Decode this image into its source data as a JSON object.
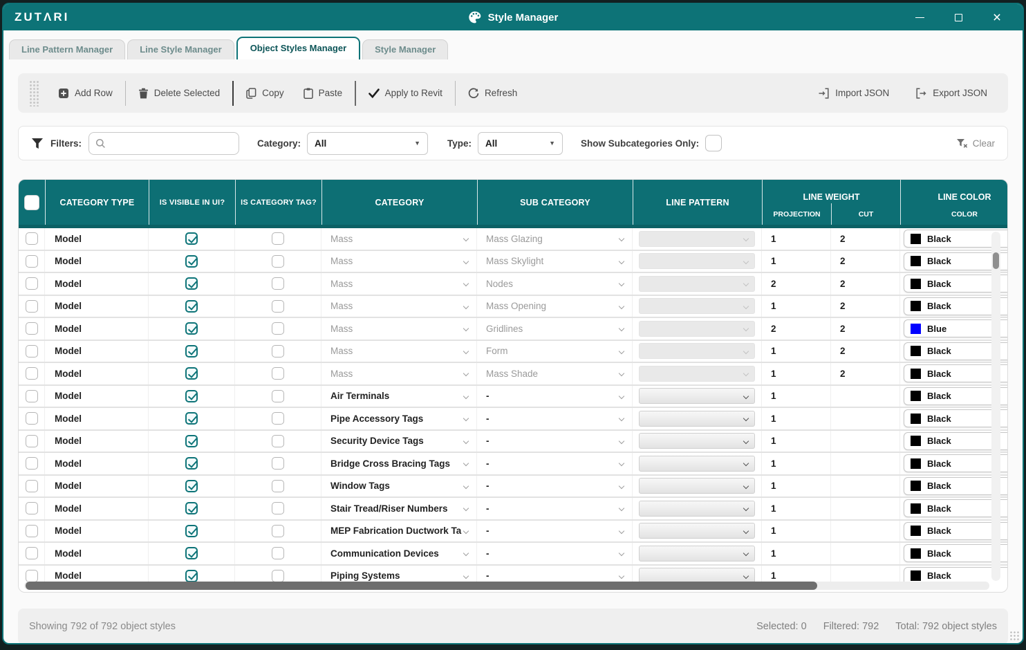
{
  "window": {
    "logo": "ZUTΛRI",
    "title": "Style Manager"
  },
  "tabs": [
    {
      "label": "Line Pattern Manager",
      "active": false
    },
    {
      "label": "Line Style Manager",
      "active": false
    },
    {
      "label": "Object Styles Manager",
      "active": true
    },
    {
      "label": "Style Manager",
      "active": false
    }
  ],
  "toolbar": {
    "add_row": "Add Row",
    "delete_selected": "Delete Selected",
    "copy": "Copy",
    "paste": "Paste",
    "apply": "Apply to Revit",
    "refresh": "Refresh",
    "import_json": "Import JSON",
    "export_json": "Export JSON"
  },
  "filters": {
    "label": "Filters:",
    "search_value": "",
    "category_label": "Category:",
    "category_value": "All",
    "type_label": "Type:",
    "type_value": "All",
    "subcategories_label": "Show Subcategories Only:",
    "subcategories_checked": false,
    "clear_label": "Clear"
  },
  "table": {
    "header": {
      "category_type": "CATEGORY TYPE",
      "is_visible": "IS VISIBLE IN UI?",
      "is_category_tag": "IS CATEGORY TAG?",
      "category": "CATEGORY",
      "sub_category": "SUB CATEGORY",
      "line_pattern": "LINE PATTERN",
      "line_weight": "LINE WEIGHT",
      "projection": "PROJECTION",
      "cut": "CUT",
      "line_color": "LINE COLOR",
      "color": "COLOR"
    },
    "rows": [
      {
        "category_type": "Model",
        "visible": true,
        "is_tag": false,
        "category": "Mass",
        "category_muted": true,
        "subcategory": "Mass Glazing",
        "subcategory_muted": true,
        "pattern_disabled": true,
        "projection": "1",
        "cut": "2",
        "color_name": "Black",
        "color_hex": "#000000"
      },
      {
        "category_type": "Model",
        "visible": true,
        "is_tag": false,
        "category": "Mass",
        "category_muted": true,
        "subcategory": "Mass Skylight",
        "subcategory_muted": true,
        "pattern_disabled": true,
        "projection": "1",
        "cut": "2",
        "color_name": "Black",
        "color_hex": "#000000"
      },
      {
        "category_type": "Model",
        "visible": true,
        "is_tag": false,
        "category": "Mass",
        "category_muted": true,
        "subcategory": "Nodes",
        "subcategory_muted": true,
        "pattern_disabled": true,
        "projection": "2",
        "cut": "2",
        "color_name": "Black",
        "color_hex": "#000000"
      },
      {
        "category_type": "Model",
        "visible": true,
        "is_tag": false,
        "category": "Mass",
        "category_muted": true,
        "subcategory": "Mass Opening",
        "subcategory_muted": true,
        "pattern_disabled": true,
        "projection": "1",
        "cut": "2",
        "color_name": "Black",
        "color_hex": "#000000"
      },
      {
        "category_type": "Model",
        "visible": true,
        "is_tag": false,
        "category": "Mass",
        "category_muted": true,
        "subcategory": "Gridlines",
        "subcategory_muted": true,
        "pattern_disabled": true,
        "projection": "2",
        "cut": "2",
        "color_name": "Blue",
        "color_hex": "#0000ff"
      },
      {
        "category_type": "Model",
        "visible": true,
        "is_tag": false,
        "category": "Mass",
        "category_muted": true,
        "subcategory": "Form",
        "subcategory_muted": true,
        "pattern_disabled": true,
        "projection": "1",
        "cut": "2",
        "color_name": "Black",
        "color_hex": "#000000"
      },
      {
        "category_type": "Model",
        "visible": true,
        "is_tag": false,
        "category": "Mass",
        "category_muted": true,
        "subcategory": "Mass Shade",
        "subcategory_muted": true,
        "pattern_disabled": true,
        "projection": "1",
        "cut": "2",
        "color_name": "Black",
        "color_hex": "#000000"
      },
      {
        "category_type": "Model",
        "visible": true,
        "is_tag": false,
        "category": "Air Terminals",
        "category_muted": false,
        "subcategory": "-",
        "subcategory_muted": false,
        "pattern_disabled": false,
        "projection": "1",
        "cut": "",
        "color_name": "Black",
        "color_hex": "#000000"
      },
      {
        "category_type": "Model",
        "visible": true,
        "is_tag": false,
        "category": "Pipe Accessory Tags",
        "category_muted": false,
        "subcategory": "-",
        "subcategory_muted": false,
        "pattern_disabled": false,
        "projection": "1",
        "cut": "",
        "color_name": "Black",
        "color_hex": "#000000"
      },
      {
        "category_type": "Model",
        "visible": true,
        "is_tag": false,
        "category": "Security Device Tags",
        "category_muted": false,
        "subcategory": "-",
        "subcategory_muted": false,
        "pattern_disabled": false,
        "projection": "1",
        "cut": "",
        "color_name": "Black",
        "color_hex": "#000000"
      },
      {
        "category_type": "Model",
        "visible": true,
        "is_tag": false,
        "category": "Bridge Cross Bracing Tags",
        "category_muted": false,
        "subcategory": "-",
        "subcategory_muted": false,
        "pattern_disabled": false,
        "projection": "1",
        "cut": "",
        "color_name": "Black",
        "color_hex": "#000000"
      },
      {
        "category_type": "Model",
        "visible": true,
        "is_tag": false,
        "category": "Window Tags",
        "category_muted": false,
        "subcategory": "-",
        "subcategory_muted": false,
        "pattern_disabled": false,
        "projection": "1",
        "cut": "",
        "color_name": "Black",
        "color_hex": "#000000"
      },
      {
        "category_type": "Model",
        "visible": true,
        "is_tag": false,
        "category": "Stair Tread/Riser Numbers",
        "category_muted": false,
        "subcategory": "-",
        "subcategory_muted": false,
        "pattern_disabled": false,
        "projection": "1",
        "cut": "",
        "color_name": "Black",
        "color_hex": "#000000"
      },
      {
        "category_type": "Model",
        "visible": true,
        "is_tag": false,
        "category": "MEP Fabrication Ductwork Ta",
        "category_muted": false,
        "subcategory": "-",
        "subcategory_muted": false,
        "pattern_disabled": false,
        "projection": "1",
        "cut": "",
        "color_name": "Black",
        "color_hex": "#000000"
      },
      {
        "category_type": "Model",
        "visible": true,
        "is_tag": false,
        "category": "Communication Devices",
        "category_muted": false,
        "subcategory": "-",
        "subcategory_muted": false,
        "pattern_disabled": false,
        "projection": "1",
        "cut": "",
        "color_name": "Black",
        "color_hex": "#000000"
      },
      {
        "category_type": "Model",
        "visible": true,
        "is_tag": false,
        "category": "Piping Systems",
        "category_muted": false,
        "subcategory": "-",
        "subcategory_muted": false,
        "pattern_disabled": false,
        "projection": "1",
        "cut": "",
        "color_name": "Black",
        "color_hex": "#000000"
      }
    ]
  },
  "status": {
    "showing": "Showing 792 of 792 object styles",
    "selected": "Selected: 0",
    "filtered": "Filtered: 792",
    "total": "Total: 792 object styles"
  },
  "colors": {
    "accent": "#0d7377",
    "header_teal": "#0d6f74",
    "blue": "#0000ff",
    "black": "#000000"
  }
}
